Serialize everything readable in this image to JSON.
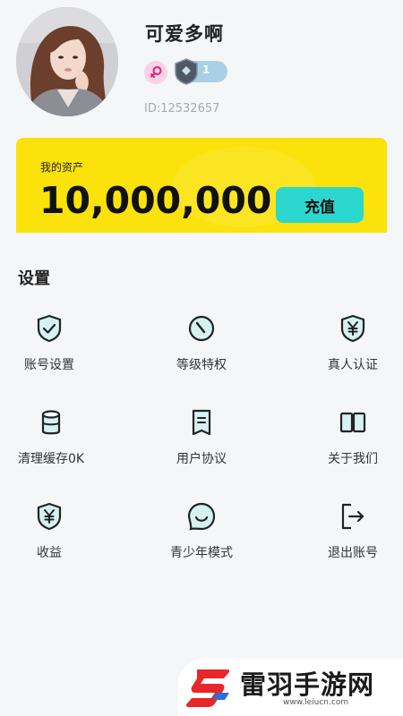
{
  "profile": {
    "username": "可爱多啊",
    "level": "1",
    "user_id": "ID:12532657"
  },
  "assets": {
    "label": "我的资产",
    "value": "10,000,000",
    "recharge_label": "充值"
  },
  "settings": {
    "title": "设置",
    "items": [
      {
        "label": "账号设置",
        "icon": "shield-check-icon"
      },
      {
        "label": "等级特权",
        "icon": "gauge-icon"
      },
      {
        "label": "真人认证",
        "icon": "yen-shield-icon"
      },
      {
        "label": "清理缓存0K",
        "icon": "cylinder-icon"
      },
      {
        "label": "用户协议",
        "icon": "document-icon"
      },
      {
        "label": "关于我们",
        "icon": "book-icon"
      },
      {
        "label": "收益",
        "icon": "yen-shield-icon"
      },
      {
        "label": "青少年模式",
        "icon": "smile-bubble-icon"
      },
      {
        "label": "退出账号",
        "icon": "logout-icon"
      }
    ]
  },
  "watermark": {
    "brand": "雷羽手游网",
    "url": "www.leiucn.com"
  },
  "colors": {
    "asset_card": "#fbe20a",
    "accent_teal": "#2bd7cf",
    "female_badge": "#f8d3e6",
    "level_badge": "#a9d0e6",
    "watermark_red": "#e8272b"
  }
}
